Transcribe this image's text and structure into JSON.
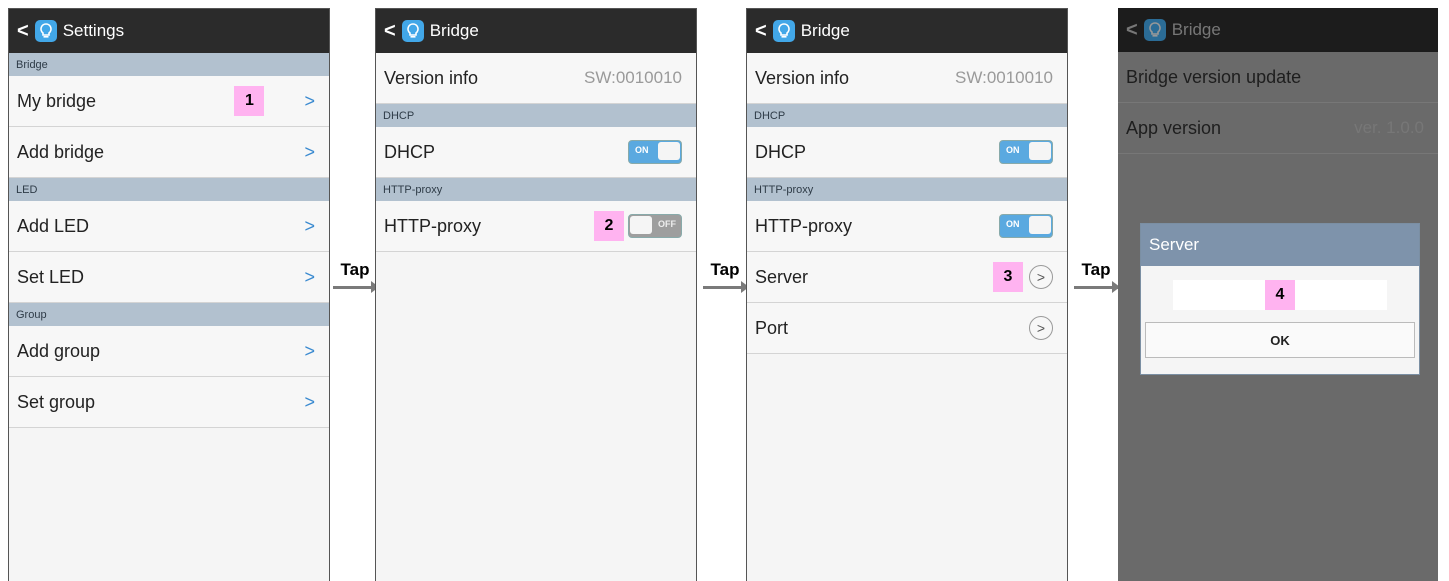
{
  "screens": [
    {
      "title": "Settings",
      "sections": [
        {
          "header": "Bridge",
          "rows": [
            {
              "label": "My bridge",
              "badge": "1",
              "chevron": ">"
            },
            {
              "label": "Add bridge",
              "chevron": ">"
            }
          ]
        },
        {
          "header": "LED",
          "rows": [
            {
              "label": "Add LED",
              "chevron": ">"
            },
            {
              "label": "Set LED",
              "chevron": ">"
            }
          ]
        },
        {
          "header": "Group",
          "rows": [
            {
              "label": "Add group",
              "chevron": ">"
            },
            {
              "label": "Set group",
              "chevron": ">"
            }
          ]
        }
      ]
    },
    {
      "title": "Bridge",
      "version_label": "Version info",
      "version_value": "SW:0010010",
      "dhcp_section": "DHCP",
      "dhcp_label": "DHCP",
      "dhcp_toggle": "ON",
      "proxy_section": "HTTP-proxy",
      "proxy_label": "HTTP-proxy",
      "proxy_badge": "2",
      "proxy_toggle": "OFF"
    },
    {
      "title": "Bridge",
      "version_label": "Version info",
      "version_value": "SW:0010010",
      "dhcp_section": "DHCP",
      "dhcp_label": "DHCP",
      "dhcp_toggle": "ON",
      "proxy_section": "HTTP-proxy",
      "proxy_label": "HTTP-proxy",
      "proxy_toggle": "ON",
      "server_label": "Server",
      "server_badge": "3",
      "port_label": "Port"
    },
    {
      "title": "Bridge",
      "update_label": "Bridge version update",
      "app_version_label": "App version",
      "app_version_value": "ver. 1.0.0",
      "dialog_title": "Server",
      "dialog_badge": "4",
      "dialog_ok": "OK"
    }
  ],
  "tap_label": "Tap",
  "colors": {
    "appbar": "#2b2b2b",
    "section": "#b2c1cf",
    "badge": "#ffb3f0",
    "toggle_on": "#5aa9e0",
    "app_icon": "#42a7e8"
  }
}
